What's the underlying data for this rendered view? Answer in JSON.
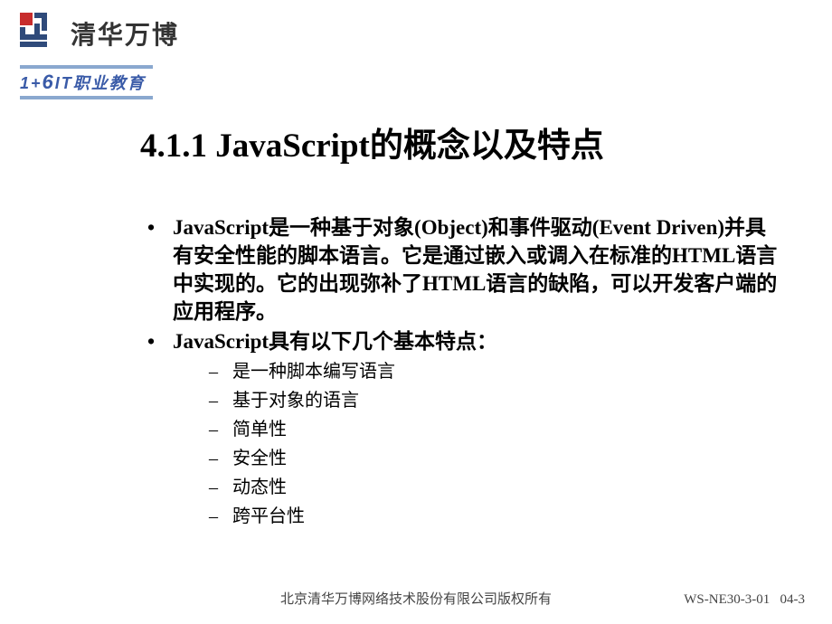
{
  "header": {
    "brand": "清华万博",
    "sub_brand_prefix": "1+",
    "sub_brand_six": "6",
    "sub_brand_suffix": "IT职业教育"
  },
  "title": "4.1.1 JavaScript的概念以及特点",
  "bullets": [
    {
      "text": "JavaScript是一种基于对象(Object)和事件驱动(Event Driven)并具有安全性能的脚本语言。它是通过嵌入或调入在标准的HTML语言中实现的。它的出现弥补了HTML语言的缺陷，可以开发客户端的应用程序。"
    },
    {
      "text": "JavaScript具有以下几个基本特点："
    }
  ],
  "sub_points": [
    "是一种脚本编写语言",
    "基于对象的语言",
    "简单性",
    "安全性",
    "动态性",
    "跨平台性"
  ],
  "footer": {
    "copyright": "北京清华万博网络技术股份有限公司版权所有",
    "code": "WS-NE30-3-01",
    "page": "04-3"
  }
}
